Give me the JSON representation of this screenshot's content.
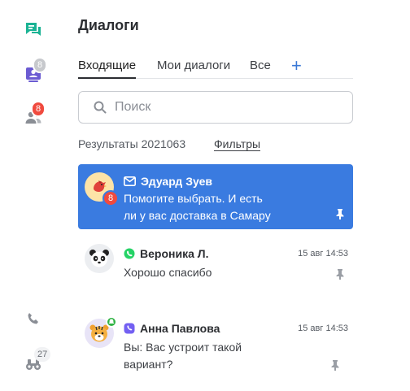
{
  "rail": {
    "chats_badge": "",
    "queue_badge": "8",
    "users_badge": "8",
    "bots_badge": "27"
  },
  "header": {
    "title": "Диалоги"
  },
  "tabs": [
    {
      "label": "Входящие"
    },
    {
      "label": "Мои диалоги"
    },
    {
      "label": "Все"
    }
  ],
  "tab_add": "+",
  "search": {
    "placeholder": "Поиск",
    "value": ""
  },
  "results": {
    "label": "Результаты 2021063",
    "filters_label": "Фильтры"
  },
  "dialogs": [
    {
      "name": "Эдуард Зуев",
      "channel_icon": "mail-icon",
      "preview_line1": "Помогите выбрать. И есть",
      "preview_line2": "ли у вас доставка в Самару",
      "unread": "8",
      "time": "",
      "active": true
    },
    {
      "name": "Вероника Л.",
      "channel_icon": "whatsapp-icon",
      "preview_line1": "Хорошо спасибо",
      "preview_line2": "",
      "time": "15 авг 14:53"
    },
    {
      "name": "Анна Павлова",
      "channel_icon": "viber-icon",
      "preview_line1": "Вы: Вас устроит такой",
      "preview_line2": "вариант?",
      "time": "15 авг 14:53"
    }
  ],
  "colors": {
    "accent": "#3a7be0",
    "rail_green": "#1ab394",
    "rail_purple": "#6b5bd2",
    "badge_red": "#f04a3e"
  }
}
